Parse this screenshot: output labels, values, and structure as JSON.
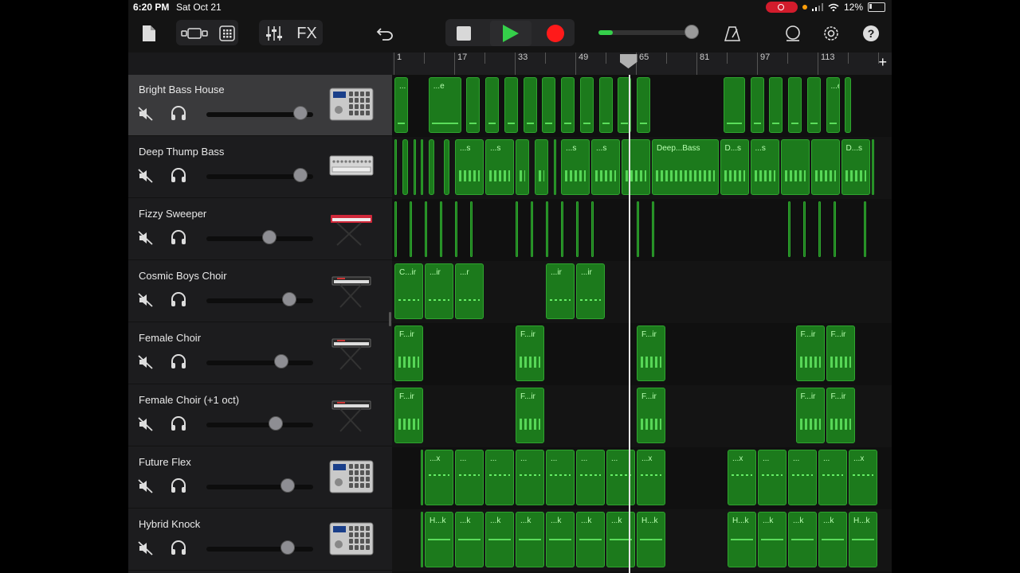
{
  "status": {
    "time": "6:20 PM",
    "date": "Sat Oct 21",
    "battery": "12%"
  },
  "toolbar": {
    "fx_label": "FX"
  },
  "ruler": {
    "bars": [
      "1",
      "17",
      "33",
      "49",
      "65",
      "81",
      "97",
      "113"
    ],
    "add_label": "+"
  },
  "tracks": [
    {
      "name": "Bright Bass House",
      "volume": 0.95,
      "instrument": "drum-machine-icon",
      "selected": true
    },
    {
      "name": "Deep Thump Bass",
      "volume": 0.95,
      "instrument": "synth-module-icon"
    },
    {
      "name": "Fizzy Sweeper",
      "volume": 0.64,
      "instrument": "red-keyboard-icon"
    },
    {
      "name": "Cosmic Boys Choir",
      "volume": 0.84,
      "instrument": "keyboard-stand-icon"
    },
    {
      "name": "Female Choir",
      "volume": 0.76,
      "instrument": "keyboard-stand-icon"
    },
    {
      "name": "Female Choir (+1 oct)",
      "volume": 0.7,
      "instrument": "keyboard-stand-icon"
    },
    {
      "name": "Future Flex",
      "volume": 0.82,
      "instrument": "drum-machine-icon"
    },
    {
      "name": "Hybrid Knock",
      "volume": 0.82,
      "instrument": "drum-machine-icon"
    }
  ],
  "lanes": [
    {
      "regions": [
        {
          "s": 1,
          "e": 5,
          "label": "..."
        },
        {
          "s": 10,
          "e": 19,
          "label": "...e"
        },
        {
          "s": 20,
          "e": 24,
          "label": ""
        },
        {
          "s": 25,
          "e": 29,
          "label": ""
        },
        {
          "s": 30,
          "e": 34,
          "label": ""
        },
        {
          "s": 35,
          "e": 39,
          "label": ""
        },
        {
          "s": 40,
          "e": 44,
          "label": ""
        },
        {
          "s": 45,
          "e": 49,
          "label": ""
        },
        {
          "s": 50,
          "e": 54,
          "label": ""
        },
        {
          "s": 55,
          "e": 59,
          "label": ""
        },
        {
          "s": 60,
          "e": 64,
          "label": ""
        },
        {
          "s": 65,
          "e": 69,
          "label": ""
        },
        {
          "s": 88,
          "e": 94,
          "label": ""
        },
        {
          "s": 95,
          "e": 99,
          "label": ""
        },
        {
          "s": 100,
          "e": 104,
          "label": ""
        },
        {
          "s": 105,
          "e": 109,
          "label": ""
        },
        {
          "s": 110,
          "e": 114,
          "label": ""
        },
        {
          "s": 115,
          "e": 119,
          "label": "...e"
        },
        {
          "s": 120,
          "e": 122,
          "label": ""
        }
      ]
    },
    {
      "regions": [
        {
          "s": 1,
          "e": 2,
          "label": ""
        },
        {
          "s": 3,
          "e": 5,
          "label": ""
        },
        {
          "s": 6,
          "e": 7,
          "label": ""
        },
        {
          "s": 8,
          "e": 9,
          "label": ""
        },
        {
          "s": 10,
          "e": 12,
          "label": ""
        },
        {
          "s": 14,
          "e": 16,
          "label": ""
        },
        {
          "s": 17,
          "e": 25,
          "label": "...s"
        },
        {
          "s": 25,
          "e": 33,
          "label": "...s"
        },
        {
          "s": 33,
          "e": 37,
          "label": ""
        },
        {
          "s": 38,
          "e": 42,
          "label": ""
        },
        {
          "s": 43,
          "e": 44,
          "label": ""
        },
        {
          "s": 45,
          "e": 53,
          "label": "...s"
        },
        {
          "s": 53,
          "e": 61,
          "label": "...s"
        },
        {
          "s": 61,
          "e": 69,
          "label": ""
        },
        {
          "s": 69,
          "e": 87,
          "label": "Deep...Bass"
        },
        {
          "s": 87,
          "e": 95,
          "label": "D...s"
        },
        {
          "s": 95,
          "e": 103,
          "label": "...s"
        },
        {
          "s": 103,
          "e": 111,
          "label": ""
        },
        {
          "s": 111,
          "e": 119,
          "label": ""
        },
        {
          "s": 119,
          "e": 127,
          "label": "D...s"
        },
        {
          "s": 127,
          "e": 128,
          "label": ""
        }
      ]
    },
    {
      "regions": [
        {
          "s": 1,
          "e": 1.6,
          "label": ""
        },
        {
          "s": 5,
          "e": 5.6,
          "label": ""
        },
        {
          "s": 9,
          "e": 9.6,
          "label": ""
        },
        {
          "s": 13,
          "e": 13.6,
          "label": ""
        },
        {
          "s": 17,
          "e": 17.6,
          "label": ""
        },
        {
          "s": 21,
          "e": 21.6,
          "label": ""
        },
        {
          "s": 33,
          "e": 33.6,
          "label": ""
        },
        {
          "s": 37,
          "e": 37.6,
          "label": ""
        },
        {
          "s": 41,
          "e": 41.6,
          "label": ""
        },
        {
          "s": 45,
          "e": 45.6,
          "label": ""
        },
        {
          "s": 49,
          "e": 49.6,
          "label": ""
        },
        {
          "s": 53,
          "e": 53.6,
          "label": ""
        },
        {
          "s": 65,
          "e": 65.6,
          "label": ""
        },
        {
          "s": 69,
          "e": 69.6,
          "label": ""
        },
        {
          "s": 105,
          "e": 105.6,
          "label": ""
        },
        {
          "s": 109,
          "e": 109.6,
          "label": ""
        },
        {
          "s": 113,
          "e": 113.6,
          "label": ""
        },
        {
          "s": 117,
          "e": 117.6,
          "label": ""
        },
        {
          "s": 125,
          "e": 125.6,
          "label": ""
        }
      ]
    },
    {
      "regions": [
        {
          "s": 1,
          "e": 9,
          "label": "C...ir"
        },
        {
          "s": 9,
          "e": 17,
          "label": "...ir"
        },
        {
          "s": 17,
          "e": 25,
          "label": "...r"
        },
        {
          "s": 41,
          "e": 49,
          "label": "...ir"
        },
        {
          "s": 49,
          "e": 57,
          "label": "...ir"
        }
      ]
    },
    {
      "regions": [
        {
          "s": 1,
          "e": 9,
          "label": "F...ir"
        },
        {
          "s": 33,
          "e": 41,
          "label": "F...ir"
        },
        {
          "s": 65,
          "e": 73,
          "label": "F...ir"
        },
        {
          "s": 107,
          "e": 115,
          "label": "F...ir"
        },
        {
          "s": 115,
          "e": 123,
          "label": "F...ir"
        }
      ]
    },
    {
      "regions": [
        {
          "s": 1,
          "e": 9,
          "label": "F...ir"
        },
        {
          "s": 33,
          "e": 41,
          "label": "F...ir"
        },
        {
          "s": 65,
          "e": 73,
          "label": "F...ir"
        },
        {
          "s": 107,
          "e": 115,
          "label": "F...ir"
        },
        {
          "s": 115,
          "e": 123,
          "label": "F...ir"
        }
      ]
    },
    {
      "regions": [
        {
          "s": 8,
          "e": 9,
          "label": ""
        },
        {
          "s": 9,
          "e": 17,
          "label": "...x"
        },
        {
          "s": 17,
          "e": 25,
          "label": "..."
        },
        {
          "s": 25,
          "e": 33,
          "label": "..."
        },
        {
          "s": 33,
          "e": 41,
          "label": "..."
        },
        {
          "s": 41,
          "e": 49,
          "label": "..."
        },
        {
          "s": 49,
          "e": 57,
          "label": "..."
        },
        {
          "s": 57,
          "e": 65,
          "label": "..."
        },
        {
          "s": 65,
          "e": 73,
          "label": "...x"
        },
        {
          "s": 89,
          "e": 97,
          "label": "...x"
        },
        {
          "s": 97,
          "e": 105,
          "label": "..."
        },
        {
          "s": 105,
          "e": 113,
          "label": "..."
        },
        {
          "s": 113,
          "e": 121,
          "label": "..."
        },
        {
          "s": 121,
          "e": 129,
          "label": "...x"
        }
      ]
    },
    {
      "regions": [
        {
          "s": 8,
          "e": 9,
          "label": ""
        },
        {
          "s": 9,
          "e": 17,
          "label": "H...k"
        },
        {
          "s": 17,
          "e": 25,
          "label": "...k"
        },
        {
          "s": 25,
          "e": 33,
          "label": "...k"
        },
        {
          "s": 33,
          "e": 41,
          "label": "...k"
        },
        {
          "s": 41,
          "e": 49,
          "label": "...k"
        },
        {
          "s": 49,
          "e": 57,
          "label": "...k"
        },
        {
          "s": 57,
          "e": 65,
          "label": "...k"
        },
        {
          "s": 65,
          "e": 73,
          "label": "H...k"
        },
        {
          "s": 89,
          "e": 97,
          "label": "H...k"
        },
        {
          "s": 97,
          "e": 105,
          "label": "...k"
        },
        {
          "s": 105,
          "e": 113,
          "label": "...k"
        },
        {
          "s": 113,
          "e": 121,
          "label": "...k"
        },
        {
          "s": 121,
          "e": 129,
          "label": "H...k"
        }
      ]
    }
  ],
  "playhead_bar": 63,
  "colors": {
    "region": "#1c7a1c",
    "region_border": "#2fa52f",
    "accent_green": "#35d04a",
    "record_red": "#ff1a1a"
  }
}
